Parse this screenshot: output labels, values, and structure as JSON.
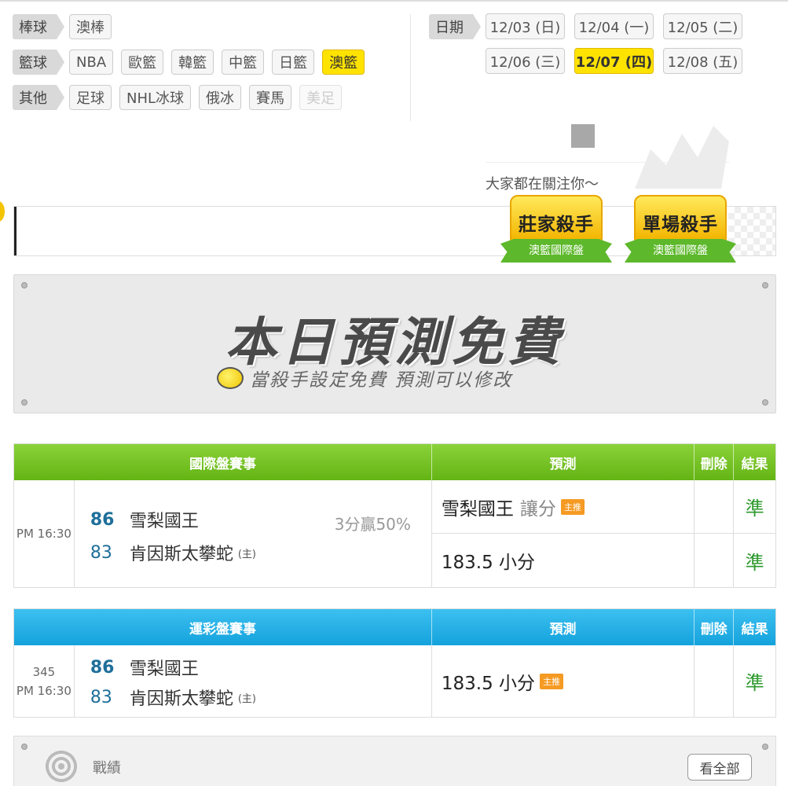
{
  "categories": [
    {
      "label": "棒球",
      "chips": [
        {
          "text": "澳棒"
        }
      ]
    },
    {
      "label": "籃球",
      "chips": [
        {
          "text": "NBA"
        },
        {
          "text": "歐籃"
        },
        {
          "text": "韓籃"
        },
        {
          "text": "中籃"
        },
        {
          "text": "日籃"
        },
        {
          "text": "澳籃",
          "active": true
        }
      ]
    },
    {
      "label": "其他",
      "chips": [
        {
          "text": "足球"
        },
        {
          "text": "NHL冰球"
        },
        {
          "text": "俄冰"
        },
        {
          "text": "賽馬"
        },
        {
          "text": "美足",
          "disabled": true
        }
      ]
    }
  ],
  "date_label": "日期",
  "dates": [
    {
      "text": "12/03 (日)"
    },
    {
      "text": "12/04 (一)"
    },
    {
      "text": "12/05 (二)"
    },
    {
      "text": "12/06 (三)"
    },
    {
      "text": "12/07 (四)",
      "active": true
    },
    {
      "text": "12/08 (五)"
    }
  ],
  "attention_text": "大家都在關注你～",
  "badges": [
    {
      "title": "莊家殺手",
      "sub": "澳籃國際盤"
    },
    {
      "title": "單場殺手",
      "sub": "澳籃國際盤"
    }
  ],
  "banner": {
    "title": "本日預測免費",
    "subtitle": "當殺手設定免費  預測可以修改"
  },
  "intl_table": {
    "headers": [
      "國際盤賽事",
      "預測",
      "刪除",
      "結果"
    ],
    "time": "PM 16:30",
    "away": {
      "score": "86",
      "team": "雪梨國王"
    },
    "home": {
      "score": "83",
      "team": "肯因斯太攀蛇",
      "home_tag": "(主)"
    },
    "odds": "3分贏50%",
    "predictions": [
      {
        "text": "雪梨國王",
        "extra": "讓分",
        "tag": "主推",
        "result": "準"
      },
      {
        "text": "183.5 小分",
        "result": "準"
      }
    ]
  },
  "lottery_table": {
    "headers": [
      "運彩盤賽事",
      "預測",
      "刪除",
      "結果"
    ],
    "number": "345",
    "time": "PM 16:30",
    "away": {
      "score": "86",
      "team": "雪梨國王"
    },
    "home": {
      "score": "83",
      "team": "肯因斯太攀蛇",
      "home_tag": "(主)"
    },
    "predictions": [
      {
        "text": "183.5 小分",
        "tag": "主推",
        "result": "準"
      }
    ]
  },
  "record": {
    "title": "戰績",
    "button": "看全部"
  },
  "colors": {
    "accent_yellow": "#ffe300",
    "header_green": "#64b414",
    "header_blue": "#14a2dc",
    "result_green": "#2e9a2e",
    "tag_orange": "#f59a23"
  }
}
